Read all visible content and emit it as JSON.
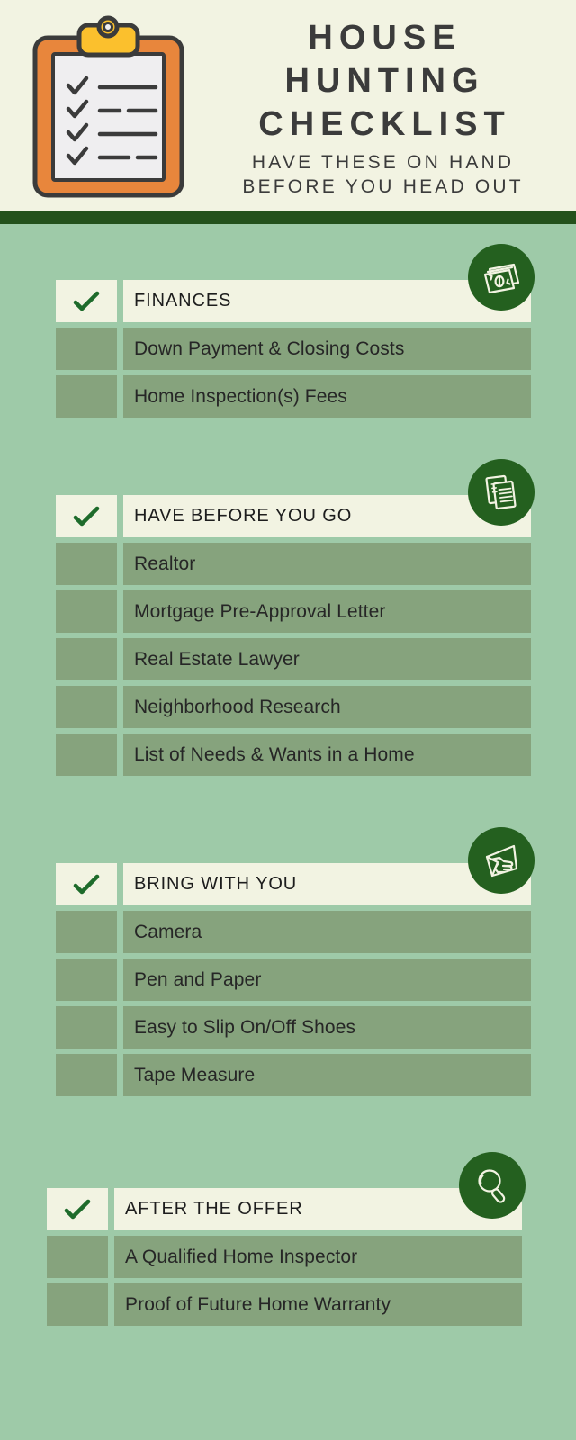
{
  "header": {
    "title_lines": [
      "HOUSE",
      "HUNTING",
      "CHECKLIST"
    ],
    "subtitle_lines": [
      "HAVE THESE ON HAND",
      "BEFORE YOU HEAD OUT"
    ],
    "clipboard_icon": "clipboard-checklist-icon"
  },
  "colors": {
    "header_bg": "#f2f3e2",
    "divider": "#24511c",
    "body_bg": "#9ecaa8",
    "row_bg": "#86a37d",
    "head_row_bg": "#f2f3e2",
    "badge_bg": "#24601f",
    "check_green": "#1e6b2b",
    "title_text": "#3b3b3b",
    "row_text": "#262626",
    "clipboard_frame": "#e8863c",
    "clipboard_clip": "#fbc02d",
    "clipboard_paper": "#efeef0",
    "clipboard_outline": "#3b3b3b"
  },
  "sections": [
    {
      "id": "finances",
      "heading": "FINANCES",
      "badge_icon": "money-cash-icon",
      "check_icon": "checkmark-icon",
      "items": [
        "Down Payment & Closing Costs",
        "Home Inspection(s) Fees"
      ]
    },
    {
      "id": "have-before-you-go",
      "heading": "HAVE BEFORE YOU GO",
      "badge_icon": "documents-icon",
      "check_icon": "checkmark-icon",
      "items": [
        "Realtor",
        "Mortgage Pre-Approval Letter",
        "Real Estate Lawyer",
        "Neighborhood Research",
        "List of Needs & Wants in a Home"
      ]
    },
    {
      "id": "bring-with-you",
      "heading": "BRING WITH YOU",
      "badge_icon": "hand-holding-document-icon",
      "check_icon": "checkmark-icon",
      "items": [
        "Camera",
        "Pen and Paper",
        "Easy to Slip On/Off Shoes",
        "Tape Measure"
      ]
    },
    {
      "id": "after-the-offer",
      "heading": "AFTER THE OFFER",
      "badge_icon": "magnifying-glass-icon",
      "check_icon": "checkmark-icon",
      "items": [
        "A Qualified Home Inspector",
        "Proof of Future Home Warranty"
      ]
    }
  ]
}
